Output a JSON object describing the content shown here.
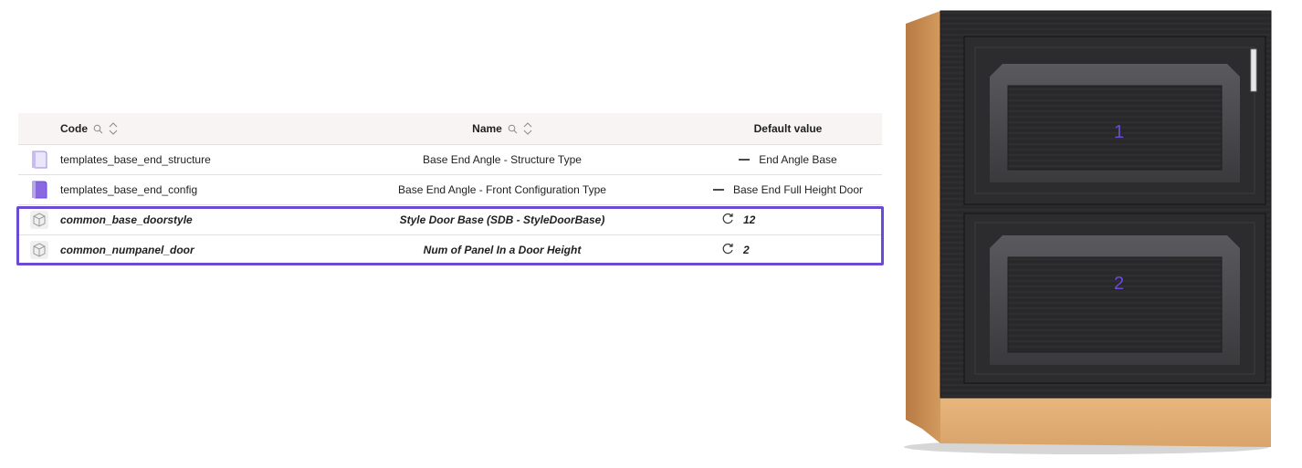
{
  "table": {
    "headers": {
      "code": "Code",
      "name": "Name",
      "default": "Default value"
    },
    "rows": [
      {
        "icon": "template-file-icon",
        "code": "templates_base_end_structure",
        "name": "Base End Angle - Structure Type",
        "default": "End Angle Base",
        "marker": "dash"
      },
      {
        "icon": "template-config-icon",
        "code": "templates_base_end_config",
        "name": "Base End Angle - Front Configuration Type",
        "default": "Base End Full Height Door",
        "marker": "dash"
      },
      {
        "icon": "cube-icon",
        "code": "common_base_doorstyle",
        "name": "Style Door Base (SDB - StyleDoorBase)",
        "default": "12",
        "marker": "refresh"
      },
      {
        "icon": "cube-icon",
        "code": "common_numpanel_door",
        "name": "Num of Panel In a Door Height",
        "default": "2",
        "marker": "refresh"
      }
    ]
  },
  "cabinet": {
    "panel_labels": [
      "1",
      "2"
    ]
  },
  "colors": {
    "accent": "#6b4ad6",
    "header_bg": "#f7f4f3",
    "cabinet_wood": "#2b2b2d",
    "cabinet_side": "#c98f55"
  }
}
